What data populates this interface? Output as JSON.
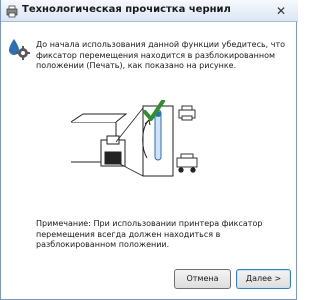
{
  "window": {
    "title": "Технологическая прочистка чернил",
    "close_symbol": "✕"
  },
  "message": "До начала использования данной функции убедитесь, что фиксатор перемещения находится в разблокированном положении (Печать), как показано на рисунке.",
  "note": "Примечание: При использовании принтера фиксатор перемещения всегда должен находиться в разблокированном положении.",
  "buttons": {
    "cancel": "Отмена",
    "next": "Далее >"
  },
  "colors": {
    "check": "#2f8f2f",
    "accent": "#2c6fb3"
  },
  "icons": [
    "printer-app-icon",
    "ink-gear-icon",
    "checkmark-icon",
    "printer-icon",
    "transport-icon"
  ]
}
